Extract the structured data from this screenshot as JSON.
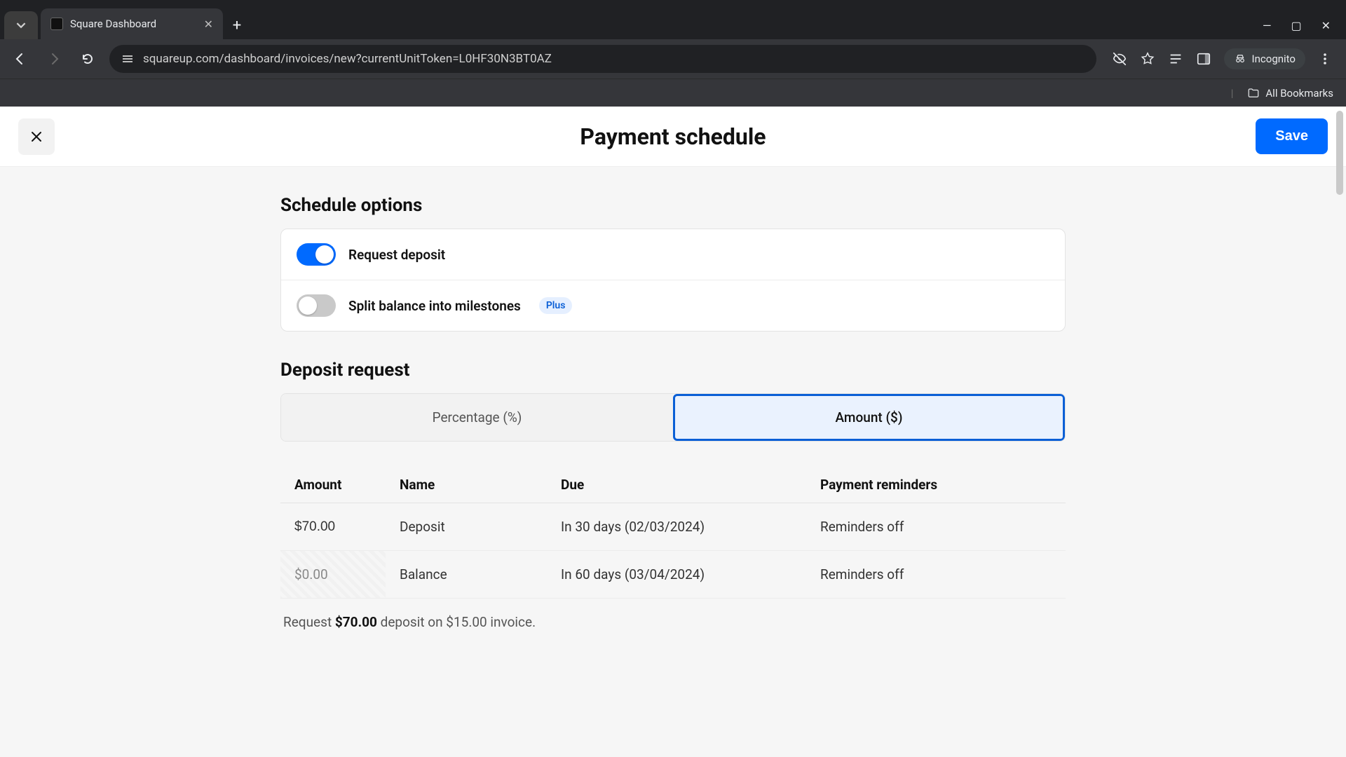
{
  "browser": {
    "tab_title": "Square Dashboard",
    "url": "squareup.com/dashboard/invoices/new?currentUnitToken=L0HF30N3BT0AZ",
    "incognito_label": "Incognito",
    "all_bookmarks": "All Bookmarks"
  },
  "header": {
    "title": "Payment schedule",
    "save": "Save"
  },
  "schedule_options": {
    "heading": "Schedule options",
    "request_deposit": {
      "label": "Request deposit",
      "on": true
    },
    "split_milestones": {
      "label": "Split balance into milestones",
      "on": false,
      "badge": "Plus"
    }
  },
  "deposit_request": {
    "heading": "Deposit request",
    "tabs": {
      "pct": "Percentage (%)",
      "amt": "Amount ($)",
      "active": "amt"
    },
    "columns": {
      "amount": "Amount",
      "name": "Name",
      "due": "Due",
      "reminders": "Payment reminders"
    },
    "rows": [
      {
        "amount": "$70.00",
        "name": "Deposit",
        "due": "In 30 days (02/03/2024)",
        "reminders": "Reminders off",
        "editable_amount": true
      },
      {
        "amount": "$0.00",
        "name": "Balance",
        "due": "In 60 days (03/04/2024)",
        "reminders": "Reminders off",
        "editable_amount": false
      }
    ],
    "summary_prefix": "Request ",
    "summary_amount": "$70.00",
    "summary_suffix": " deposit on $15.00 invoice."
  }
}
